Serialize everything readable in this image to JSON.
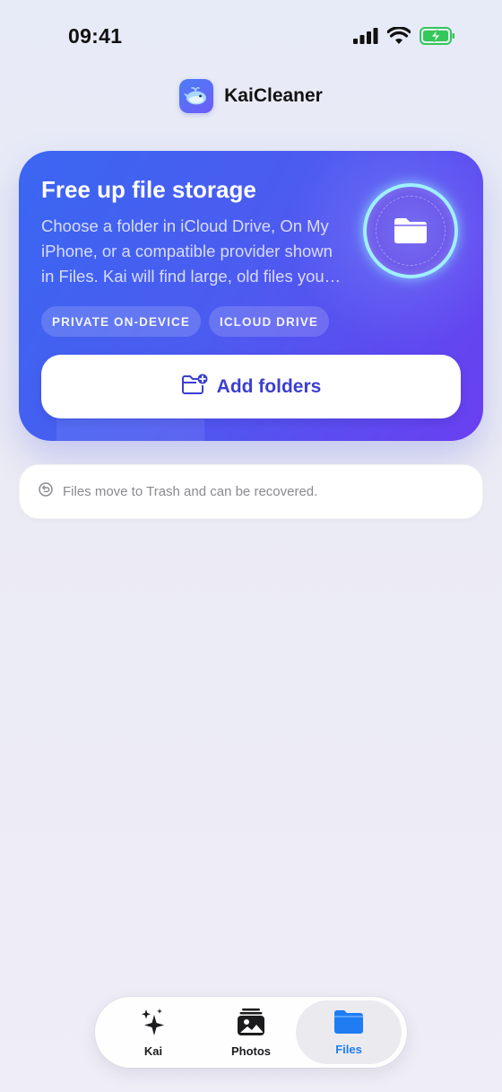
{
  "status_bar": {
    "time": "09:41"
  },
  "app": {
    "name": "KaiCleaner",
    "logo_icon": "whale-logo-icon"
  },
  "hero": {
    "title": "Free up file storage",
    "description": "Choose a folder in iCloud Drive, On My iPhone, or a compatible provider shown in Files. Kai will find large, old files you no longer need.",
    "chips": [
      "PRIVATE ON-DEVICE",
      "ICLOUD DRIVE"
    ],
    "button_label": "Add folders",
    "button_icon": "folder-plus-icon",
    "hero_icon": "folder-icon"
  },
  "info": {
    "text": "Files move to Trash and can be recovered.",
    "icon": "restore-icon"
  },
  "tabs": [
    {
      "label": "Kai",
      "icon": "sparkles-icon"
    },
    {
      "label": "Photos",
      "icon": "photos-stack-icon"
    },
    {
      "label": "Files",
      "icon": "folder-icon"
    }
  ],
  "colors": {
    "hero_gradient_start": "#3a66f2",
    "hero_gradient_end": "#6a3ff0",
    "button_text": "#3b3fd0",
    "active_tab": "#1f7cf2",
    "ring_glow": "#9ff0ff"
  }
}
